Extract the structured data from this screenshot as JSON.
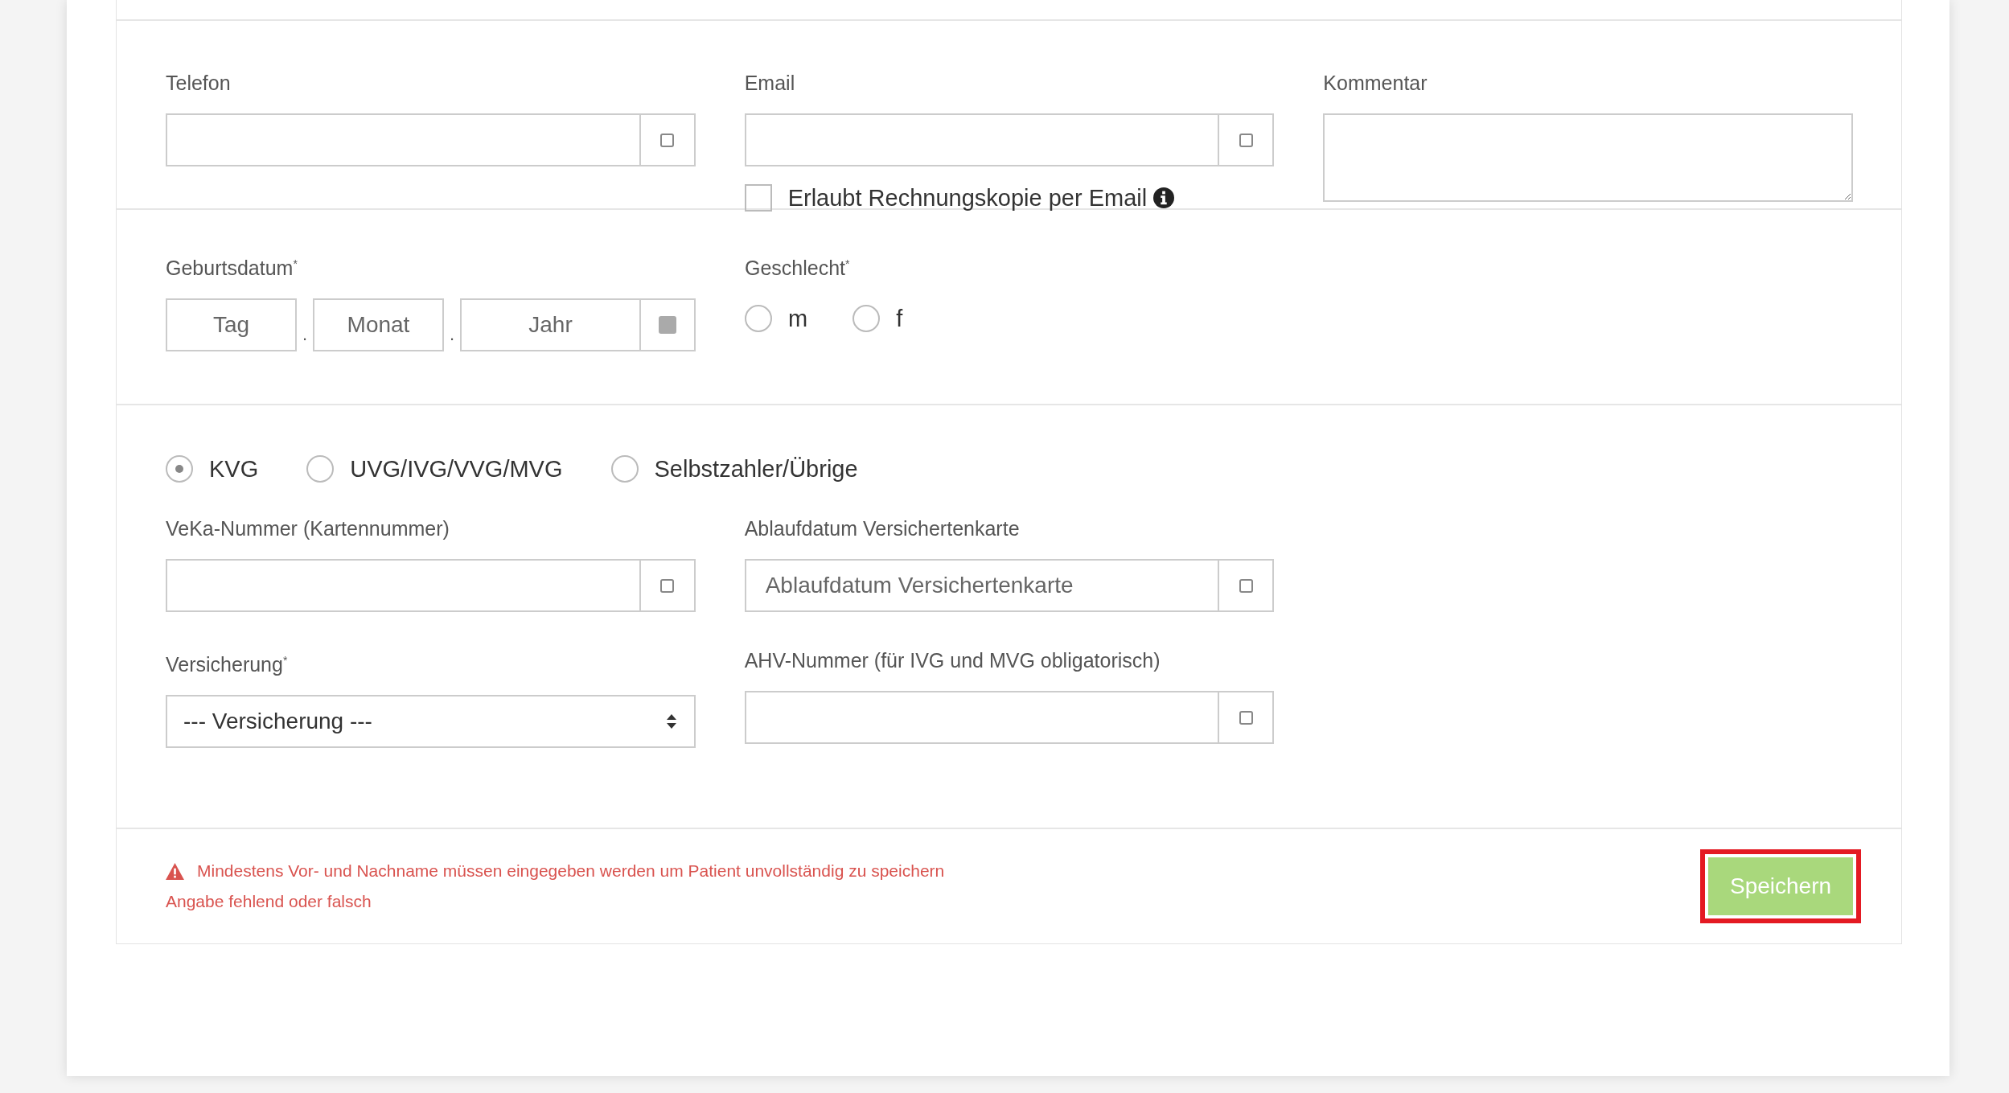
{
  "contact": {
    "phone": {
      "label": "Telefon"
    },
    "email": {
      "label": "Email"
    },
    "invoice_copy": {
      "label": "Erlaubt Rechnungskopie per Email",
      "checked": false
    },
    "comment": {
      "label": "Kommentar"
    }
  },
  "birth_date": {
    "label": "Geburtsdatum$^{*}$",
    "parts": [
      {
        "placeholder": "Tag"
      },
      {
        "placeholder": "Monat"
      },
      {
        "placeholder": "Jahr"
      }
    ],
    "separators": [
      ".",
      "."
    ]
  },
  "gender": {
    "label": "Geschlecht$^{*}$",
    "options": [
      {
        "label": "m",
        "selected": false
      },
      {
        "label": "f",
        "selected": false
      }
    ]
  },
  "insurance_type": [
    {
      "label": "KVG",
      "selected": true
    },
    {
      "label": "UVG/IVG/VVG/MVG",
      "selected": false
    },
    {
      "label": "Selbstzahler/Übrige",
      "selected": false
    }
  ],
  "card_number": {
    "label": "VeKa-Nummer (Kartennummer)"
  },
  "card_expiry": {
    "label": "Ablaufdatum Versichertenkarte",
    "placeholder": "Ablaufdatum Versichertenkarte"
  },
  "insurer": {
    "label": "Versicherung$^{*}$",
    "value": "--- Versicherung ---"
  },
  "ahv_number": {
    "label": "AHV-Nummer (für IVG und MVG obligatorisch)"
  },
  "messages": [
    {
      "kind": "warning",
      "text": "Mindestens Vor- und Nachname müssen eingegeben werden um Patient unvollständig zu speichern"
    },
    {
      "kind": "error",
      "text": "Angabe fehlend oder falsch"
    }
  ],
  "save_button": {
    "label": "Speichern"
  }
}
